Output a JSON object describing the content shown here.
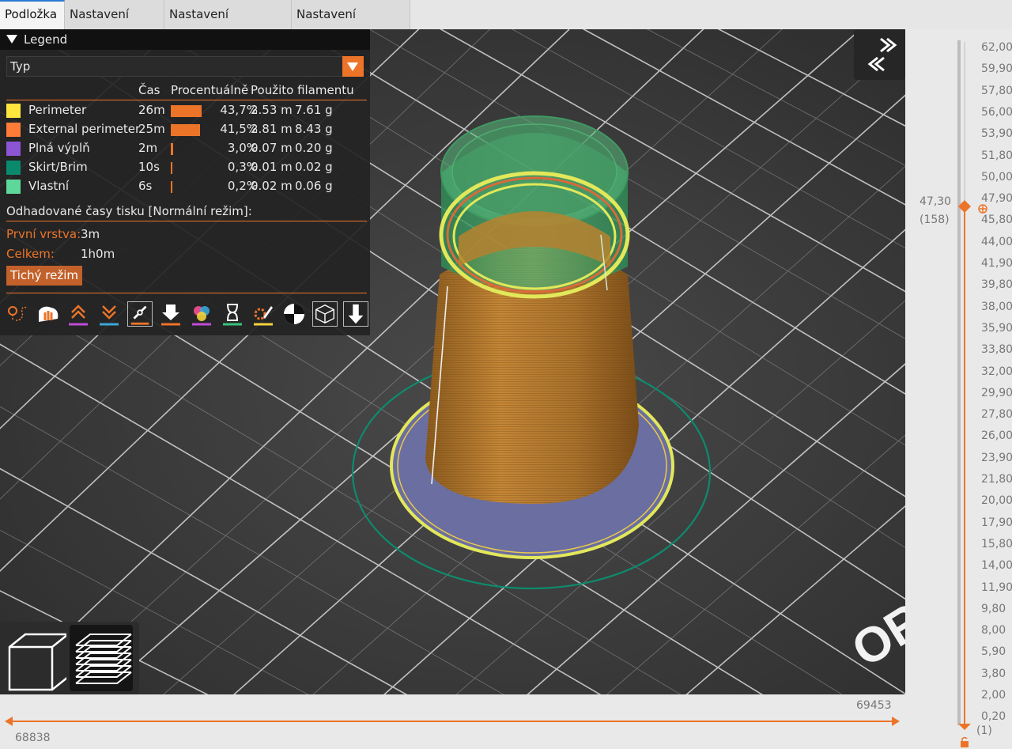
{
  "tabs": [
    {
      "label": "Podložka",
      "active": true
    },
    {
      "label": "Nastavení tisku",
      "active": false
    },
    {
      "label": "Nastavení filamentu",
      "active": false
    },
    {
      "label": "Nastavení tiskárny",
      "active": false
    }
  ],
  "legend": {
    "title": "Legend",
    "view_type": "Typ",
    "columns": {
      "time": "Čas",
      "percent": "Procentuálně",
      "used": "Použito filamentu"
    },
    "rows": [
      {
        "color": "#ffe53d",
        "label": "Perimeter",
        "time": "26m",
        "share": 0.437,
        "percent": "43,7%",
        "length": "2.53 m",
        "weight": "7.61 g"
      },
      {
        "color": "#ff7c38",
        "label": "External perimeter",
        "time": "25m",
        "share": 0.415,
        "percent": "41,5%",
        "length": "2.81 m",
        "weight": "8.43 g"
      },
      {
        "color": "#8c55d6",
        "label": "Plná výplň",
        "time": "2m",
        "share": 0.03,
        "percent": "3,0%",
        "length": "0.07 m",
        "weight": "0.20 g"
      },
      {
        "color": "#0a8a6c",
        "label": "Skirt/Brim",
        "time": "10s",
        "share": 0.003,
        "percent": "0,3%",
        "length": "0.01 m",
        "weight": "0.02 g"
      },
      {
        "color": "#5dd89a",
        "label": "Vlastní",
        "time": "6s",
        "share": 0.002,
        "percent": "0,2%",
        "length": "0.02 m",
        "weight": "0.06 g"
      }
    ],
    "estimated_times_title": "Odhadované časy tisku [Normální režim]:",
    "first_layer_label": "První vrstva:",
    "first_layer_value": "3m",
    "total_label": "Celkem:",
    "total_value": "1h0m",
    "silent_mode_button": "Tichý režim"
  },
  "toolbar_icons": [
    "travel-icon",
    "wipe-icon",
    "retractions-icon",
    "deretractions-icon",
    "seams-icon",
    "tool-changes-icon",
    "color-changes-icon",
    "pause-prints-icon",
    "custom-gcodes-icon",
    "center-of-gravity-icon",
    "shells-icon",
    "tool-marker-icon"
  ],
  "bed_text": "OR",
  "horizontal_slider": {
    "upper_value": "69453",
    "lower_value": "68838"
  },
  "vertical_slider": {
    "ticks": [
      "62,00",
      "59,90",
      "57,80",
      "56,00",
      "53,90",
      "51,80",
      "50,00",
      "47,90",
      "45,80",
      "44,00",
      "41,90",
      "39,80",
      "38,00",
      "35,90",
      "33,80",
      "32,00",
      "29,90",
      "27,80",
      "26,00",
      "23,90",
      "21,80",
      "20,00",
      "17,90",
      "15,80",
      "14,00",
      "11,90",
      "9,80",
      "8,00",
      "5,90",
      "3,80",
      "2,00",
      "0,20"
    ],
    "current_value": "47,30",
    "current_layer": "(158)",
    "bottom_layer": "(1)",
    "max_value": 62.0,
    "current_height": 47.3
  },
  "colors": {
    "accent": "#ec7429",
    "viewport_bg": "#3b3b3b",
    "grid_line": "#d8d8d8"
  }
}
